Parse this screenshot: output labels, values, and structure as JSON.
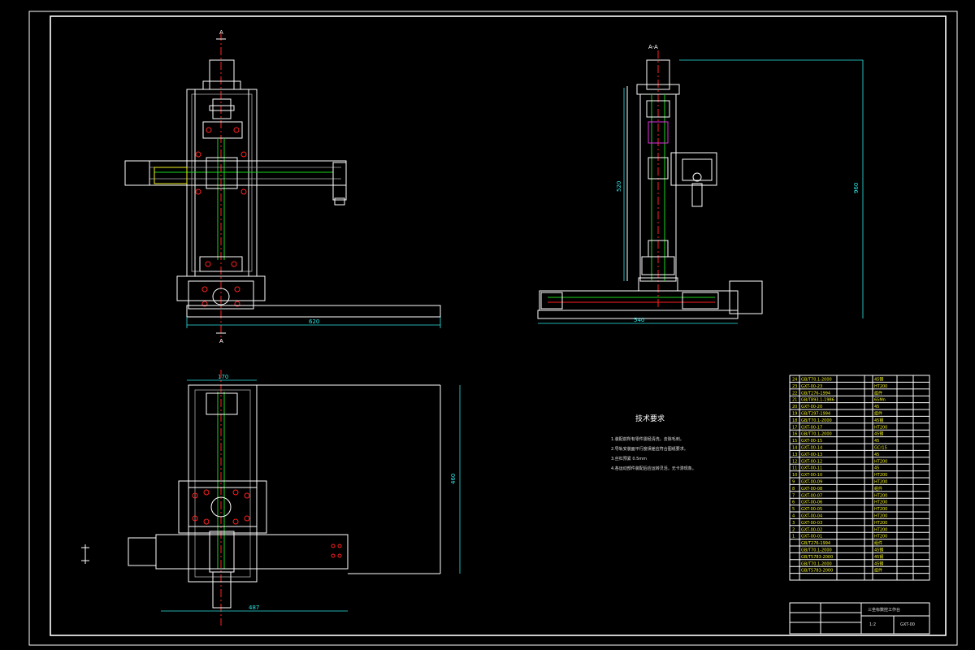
{
  "views": {
    "front": {
      "section_mark": "A",
      "dim_width": "620"
    },
    "side": {
      "section_label": "A-A",
      "dim_height": "520",
      "dim_height2": "960",
      "dim_width": "540"
    },
    "top": {
      "dim_width": "170",
      "dim_height": "460",
      "dim_width2": "487"
    }
  },
  "notes": {
    "title": "技术要求",
    "items": [
      "1.装配前所有零件需经清洗，去除毛刺。",
      "2.导轨安装面平行度误差应符合图纸要求。",
      "3.丝杠预紧 0.5mm",
      "4.各运动部件装配后应运转灵活，无卡滞现象。"
    ]
  },
  "bom": {
    "rows": [
      {
        "no": "24",
        "code": "GB/T70.1-2000",
        "mat": "45钢"
      },
      {
        "no": "23",
        "code": "GXT-00-23",
        "mat": "HT200"
      },
      {
        "no": "22",
        "code": "GB/T276-1994",
        "mat": "组件"
      },
      {
        "no": "21",
        "code": "GB/T893.1-1986",
        "mat": "65Mn"
      },
      {
        "no": "20",
        "code": "GXT-00-20",
        "mat": "45"
      },
      {
        "no": "19",
        "code": "GB/T297-1994",
        "mat": "组件"
      },
      {
        "no": "18",
        "code": "GB/T70.1-2000",
        "mat": "45钢"
      },
      {
        "no": "17",
        "code": "GXT-00-17",
        "mat": "HT200"
      },
      {
        "no": "16",
        "code": "GB/T70.1-2000",
        "mat": "45钢"
      },
      {
        "no": "15",
        "code": "GXT-00-15",
        "mat": "45"
      },
      {
        "no": "14",
        "code": "GXT-00-14",
        "mat": "GCr15"
      },
      {
        "no": "13",
        "code": "GXT-00-13",
        "mat": "45"
      },
      {
        "no": "12",
        "code": "GXT-00-12",
        "mat": "HT200"
      },
      {
        "no": "11",
        "code": "GXT-00-11",
        "mat": "45"
      },
      {
        "no": "10",
        "code": "GXT-00-10",
        "mat": "HT200"
      },
      {
        "no": "9",
        "code": "GXT-00-09",
        "mat": "HT200"
      },
      {
        "no": "8",
        "code": "GXT-00-08",
        "mat": "组件"
      },
      {
        "no": "7",
        "code": "GXT-00-07",
        "mat": "HT200"
      },
      {
        "no": "6",
        "code": "GXT-00-06",
        "mat": "HT200"
      },
      {
        "no": "5",
        "code": "GXT-00-05",
        "mat": "HT200"
      },
      {
        "no": "4",
        "code": "GXT-00-04",
        "mat": "HT200"
      },
      {
        "no": "3",
        "code": "GXT-00-03",
        "mat": "HT200"
      },
      {
        "no": "2",
        "code": "GXT-00-02",
        "mat": "HT200"
      },
      {
        "no": "1",
        "code": "GXT-00-01",
        "mat": "HT200"
      },
      {
        "no": "",
        "code": "GB/T276-1994",
        "mat": "组件"
      },
      {
        "no": "",
        "code": "GB/T70.1-2000",
        "mat": "45钢"
      },
      {
        "no": "",
        "code": "GB/T5783-2000",
        "mat": "45钢"
      },
      {
        "no": "",
        "code": "GB/T70.1-2000",
        "mat": "45钢"
      },
      {
        "no": "",
        "code": "GB/T5783-2000",
        "mat": "组件"
      }
    ]
  },
  "title_block": {
    "drawing_name": "三坐标数控工作台",
    "drawing_no": "GXT-00",
    "scale": "1:2"
  }
}
